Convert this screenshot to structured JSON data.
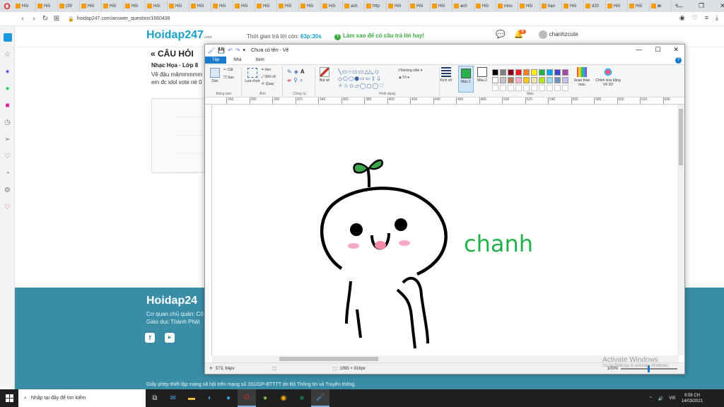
{
  "browser": {
    "tabs": [
      "Hỏi",
      "Hỏi",
      "(39",
      "Hỏi",
      "Hỏi",
      "Hỏi",
      "Hỏi",
      "Hỏi",
      "Hỏi",
      "Hỏi",
      "Hỏi",
      "Hỏi",
      "Hỏi",
      "Hỏi",
      "Hỏi",
      "ach",
      "http",
      "Hỏi",
      "Hỏi",
      "Hỏi",
      "ach",
      "Hỏi",
      "mnu",
      "Hỏi",
      "bạn",
      "Hỏi",
      "d20",
      "Hỏi",
      "Hỏi",
      "m"
    ],
    "active_tab": "H",
    "url": "hoidap247.com/answer_question/1660438"
  },
  "site": {
    "logo": "Hoidap247",
    "logo_suffix": ".com",
    "timer_label": "Thời gian trả lời còn:",
    "timer_value": "63p:30s",
    "hint": "Làm sao để có câu trả lời hay!",
    "notif_count": "4",
    "username": "chanhzcute",
    "question_title": "« CÂU HỎI",
    "subject": "Nhạc Họa · Lớp 8",
    "question_line1": "Vẽ đậu mămmmmm",
    "question_line2": "em đc idol vote nè 0",
    "footer_logo": "Hoidap24",
    "footer_line1": "Cơ quan chủ quản: Cô",
    "footer_line2": "Giáo dục Thành Phát",
    "license": "Giấy phép thiết lập mạng xã hội trên mạng số 331/GP-BTTTT do Bộ Thông tin và Truyền thông."
  },
  "paint": {
    "title": "Chưa có tên - Vẽ",
    "tabs": [
      "Tệp",
      "Nhà",
      "Xem"
    ],
    "groups": {
      "clipboard": "Bảng tạm",
      "image": "Ảnh",
      "tools": "Công cụ",
      "shapes": "Hình dạng",
      "colors": "Màu"
    },
    "buttons": {
      "paste": "Dán",
      "cut": "Cắt",
      "copy": "Sao",
      "select": "Lựa chọn",
      "crop": "Xén",
      "resize": "Đổi cỡ",
      "rotate": "Quay",
      "brush": "Bút vẽ",
      "outline": "Đường viền",
      "fill": "Tô",
      "size": "Kích cỡ",
      "color1": "Màu 1",
      "color2": "Màu 2",
      "edit_colors": "Soạn thảo màu",
      "paint3d": "Chỉnh sửa bằng Vẽ 3D"
    },
    "ruler_ticks": [
      "260",
      "280",
      "300",
      "320",
      "340",
      "360",
      "380",
      "400",
      "420",
      "440",
      "460",
      "480",
      "500",
      "520",
      "540",
      "560",
      "580",
      "600",
      "620",
      "640",
      "660"
    ],
    "palette": [
      "#000000",
      "#7f7f7f",
      "#880015",
      "#ed1c24",
      "#ff7f27",
      "#fff200",
      "#22b14c",
      "#00a2e8",
      "#3f48cc",
      "#a349a4",
      "#ffffff",
      "#c3c3c3",
      "#b97a57",
      "#ffaec9",
      "#ffc90e",
      "#efe4b0",
      "#b5e61d",
      "#99d9ea",
      "#7092be",
      "#c8bfe7"
    ],
    "drawing_text": "chanh",
    "color1": "#22b14c",
    "status_pos": "573, 64px",
    "status_size": "1095 × 916px",
    "zoom": "100%"
  },
  "windows": {
    "watermark_title": "Activate Windows",
    "watermark_sub": "Go to Settings to activate Windows.",
    "search_placeholder": "Nhập tại đây để tìm kiếm",
    "lang": "VIE",
    "time": "9:59 CH",
    "date": "14/03/2021"
  }
}
